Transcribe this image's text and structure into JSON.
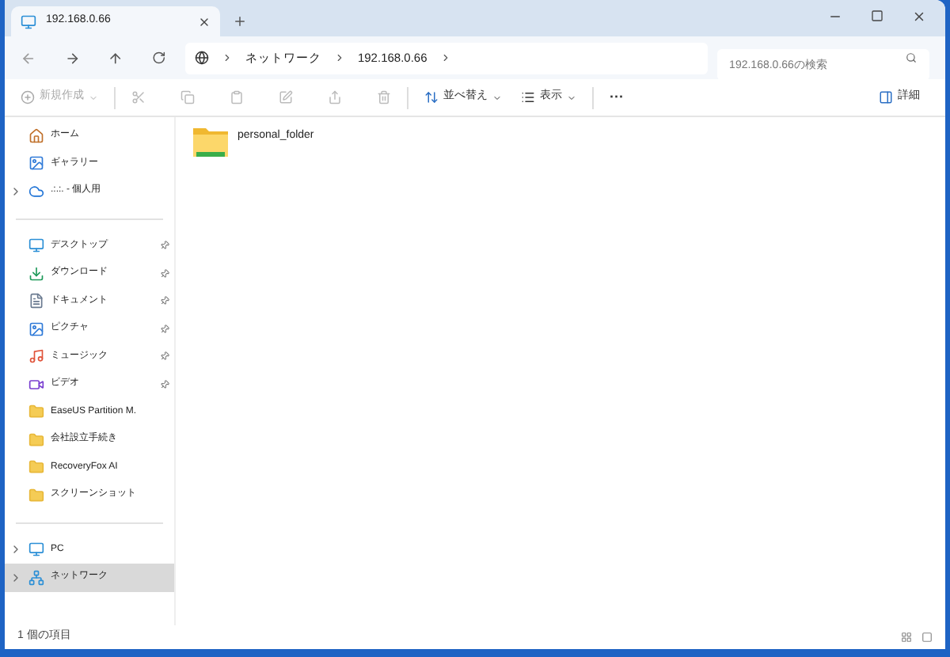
{
  "tabs": [
    {
      "label": "192.168.0.66",
      "selected": true
    }
  ],
  "breadcrumbs": [
    "ネットワーク",
    "192.168.0.66"
  ],
  "search": {
    "placeholder": "192.168.0.66の検索"
  },
  "toolbar": {
    "new": {
      "label": "新規作成",
      "disabled": true
    },
    "sort": {
      "label": "並べ替え"
    },
    "view": {
      "label": "表示"
    },
    "more": "···",
    "details": "詳細"
  },
  "sidebar": {
    "groups": [
      [
        {
          "label": "ホーム",
          "kind": "home",
          "pinned": false,
          "expandable": false,
          "selected": false
        },
        {
          "label": "ギャラリー",
          "kind": "gallery",
          "pinned": false,
          "expandable": false,
          "selected": false
        },
        {
          "label": ".:.:. - 個人用",
          "kind": "cloud",
          "pinned": false,
          "expandable": true,
          "selected": false
        }
      ],
      [
        {
          "label": "デスクトップ",
          "kind": "desktop",
          "pinned": true,
          "expandable": false,
          "selected": false
        },
        {
          "label": "ダウンロード",
          "kind": "download",
          "pinned": true,
          "expandable": false,
          "selected": false
        },
        {
          "label": "ドキュメント",
          "kind": "document",
          "pinned": true,
          "expandable": false,
          "selected": false
        },
        {
          "label": "ピクチャ",
          "kind": "gallery",
          "pinned": true,
          "expandable": false,
          "selected": false
        },
        {
          "label": "ミュージック",
          "kind": "music",
          "pinned": true,
          "expandable": false,
          "selected": false
        },
        {
          "label": "ビデオ",
          "kind": "video",
          "pinned": true,
          "expandable": false,
          "selected": false
        },
        {
          "label": "EaseUS Partition M.",
          "kind": "folder",
          "pinned": false,
          "expandable": false,
          "selected": false
        },
        {
          "label": "会社設立手続き",
          "kind": "folder",
          "pinned": false,
          "expandable": false,
          "selected": false
        },
        {
          "label": "RecoveryFox AI",
          "kind": "folder",
          "pinned": false,
          "expandable": false,
          "selected": false
        },
        {
          "label": "スクリーンショット",
          "kind": "folder",
          "pinned": false,
          "expandable": false,
          "selected": false
        }
      ],
      [
        {
          "label": "PC",
          "kind": "desktop",
          "pinned": false,
          "expandable": true,
          "selected": false
        },
        {
          "label": "ネットワーク",
          "kind": "network",
          "pinned": false,
          "expandable": true,
          "selected": true
        }
      ]
    ]
  },
  "files": [
    {
      "name": "personal_folder"
    }
  ],
  "status_bar": {
    "text": "1 個の項目"
  }
}
